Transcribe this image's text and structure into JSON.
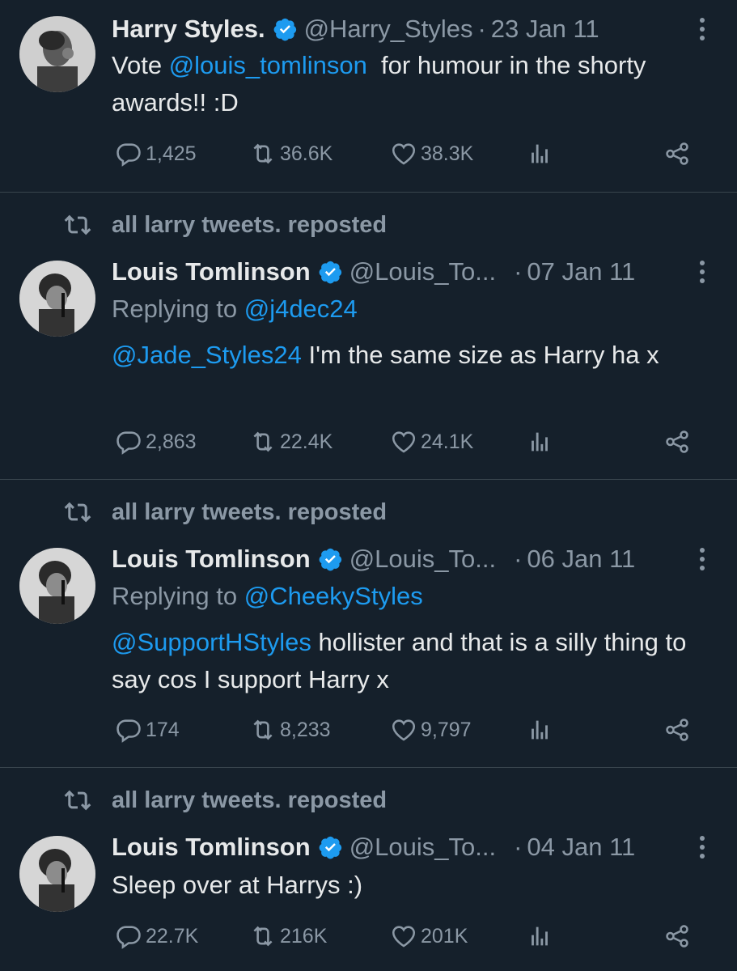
{
  "colors": {
    "background": "#15202b",
    "text": "#e7e9ea",
    "muted": "#8b98a5",
    "link": "#1d9bf0",
    "divider": "#38444d"
  },
  "tweets": [
    {
      "repost_label": "",
      "name": "Harry Styles.",
      "handle": "@Harry_Styles",
      "separator": "·",
      "date": "23 Jan 11",
      "replying_prefix": "",
      "replying_to": "",
      "text_segments": [
        {
          "text": "Vote ",
          "link": false
        },
        {
          "text": "@louis_tomlinson",
          "link": true
        },
        {
          "text": "  for humour in the shorty awards!! :D",
          "link": false
        }
      ],
      "replies": "1,425",
      "reposts": "36.6K",
      "likes": "38.3K"
    },
    {
      "repost_label": "all larry tweets. reposted",
      "name": "Louis Tomlinson",
      "handle": "@Louis_To...",
      "separator": "·",
      "date": "07 Jan 11",
      "replying_prefix": "Replying to ",
      "replying_to": "@j4dec24",
      "text_segments": [
        {
          "text": "@Jade_Styles24",
          "link": true
        },
        {
          "text": " I'm the same size as Harry ha x",
          "link": false
        }
      ],
      "replies": "2,863",
      "reposts": "22.4K",
      "likes": "24.1K"
    },
    {
      "repost_label": "all larry tweets. reposted",
      "name": "Louis Tomlinson",
      "handle": "@Louis_To...",
      "separator": "·",
      "date": "06 Jan 11",
      "replying_prefix": "Replying to ",
      "replying_to": "@CheekyStyles",
      "text_segments": [
        {
          "text": "@SupportHStyles",
          "link": true
        },
        {
          "text": " hollister and that is a silly thing to say cos I support Harry x",
          "link": false
        }
      ],
      "replies": "174",
      "reposts": "8,233",
      "likes": "9,797"
    },
    {
      "repost_label": "all larry tweets. reposted",
      "name": "Louis Tomlinson",
      "handle": "@Louis_To...",
      "separator": "·",
      "date": "04 Jan 11",
      "replying_prefix": "",
      "replying_to": "",
      "text_segments": [
        {
          "text": "Sleep over at Harrys :)",
          "link": false
        }
      ],
      "replies": "22.7K",
      "reposts": "216K",
      "likes": "201K"
    }
  ],
  "icons": {
    "repost": "repost-icon",
    "verified": "verified-badge-icon",
    "more": "more-vertical-icon",
    "reply": "reply-icon",
    "like": "like-icon",
    "views": "views-icon",
    "share": "share-icon"
  }
}
